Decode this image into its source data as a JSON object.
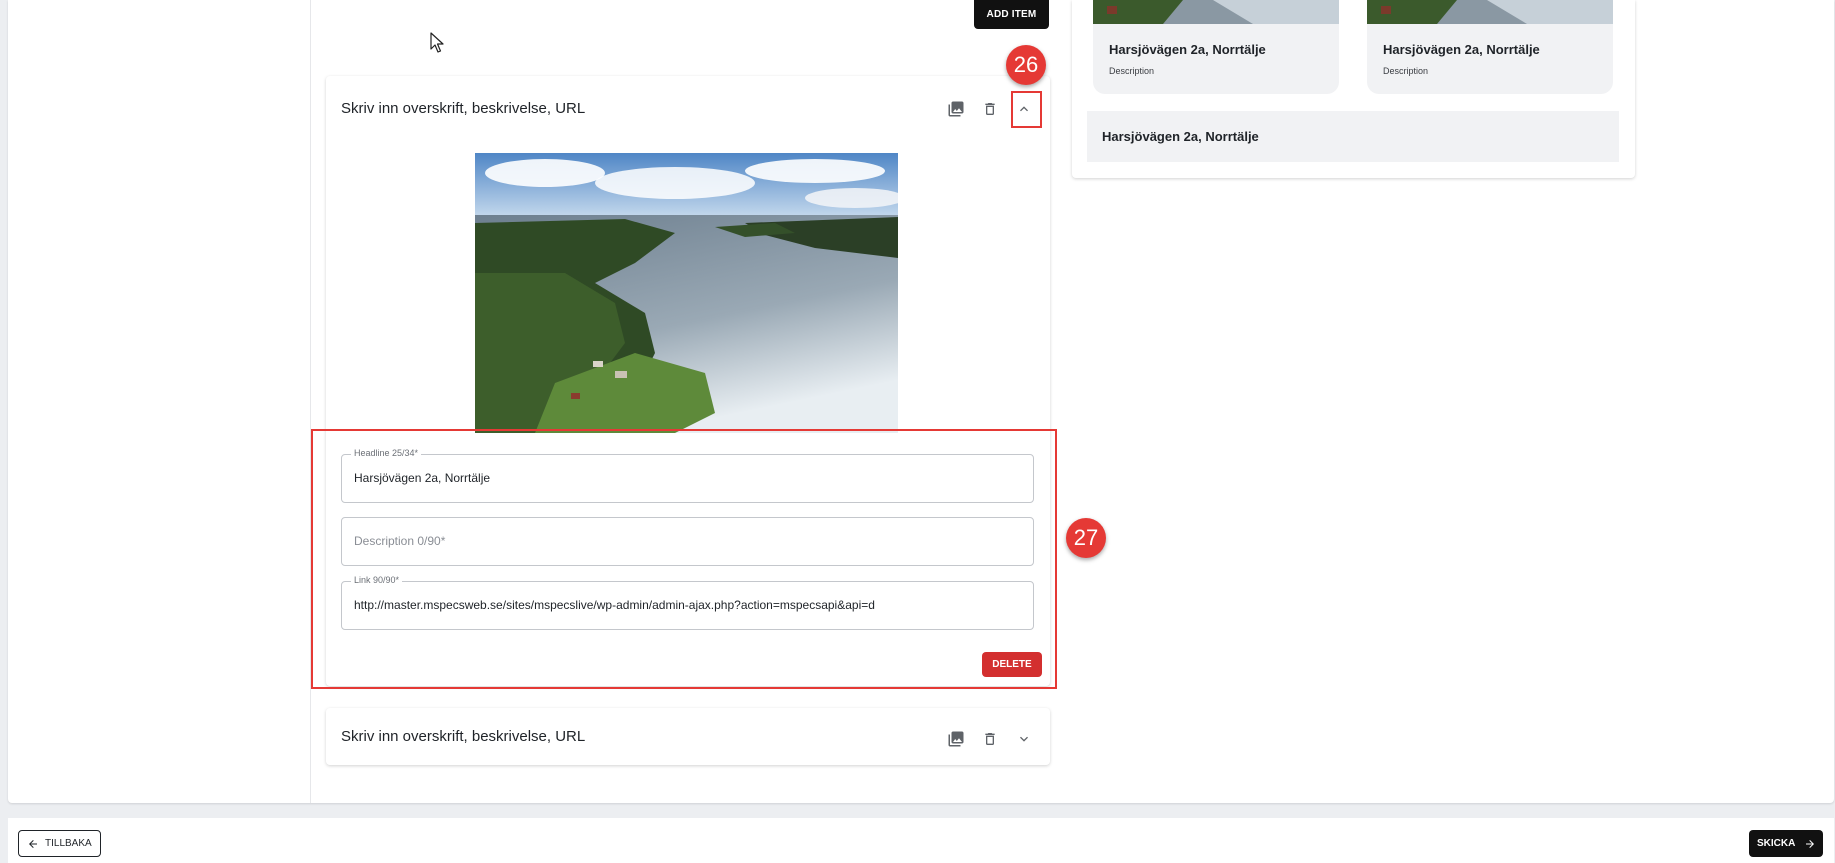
{
  "toolbar": {
    "add_item_label": "ADD ITEM"
  },
  "items": [
    {
      "title": "Skriv inn overskrift, beskrivelse, URL",
      "expanded": true,
      "fields": {
        "headline_label": "Headline 25/34*",
        "headline_value": "Harsjövägen 2a, Norrtälje",
        "description_placeholder": "Description 0/90*",
        "link_label": "Link 90/90*",
        "link_value": "http://master.mspecsweb.se/sites/mspecslive/wp-admin/admin-ajax.php?action=mspecsapi&api=d"
      },
      "delete_label": "DELETE"
    },
    {
      "title": "Skriv inn overskrift, beskrivelse, URL",
      "expanded": false
    }
  ],
  "preview": {
    "cards": [
      {
        "title": "Harsjövägen 2a, Norrtälje",
        "description": "Description"
      },
      {
        "title": "Harsjövägen 2a, Norrtälje",
        "description": "Description"
      }
    ],
    "bar_title": "Harsjövägen 2a, Norrtälje"
  },
  "annotations": {
    "badge_1": "26",
    "badge_2": "27",
    "color": "#e53935"
  },
  "footer": {
    "back_label": "TILLBAKA",
    "send_label": "SKICKA"
  },
  "icons": [
    "image-icon",
    "trash-icon",
    "chevron-up-icon",
    "chevron-down-icon",
    "arrow-left-icon",
    "arrow-right-icon",
    "cursor-icon"
  ],
  "colors": {
    "primary_dark": "#111111",
    "danger": "#d32f2f",
    "panel_bg": "#f1f2f4"
  }
}
